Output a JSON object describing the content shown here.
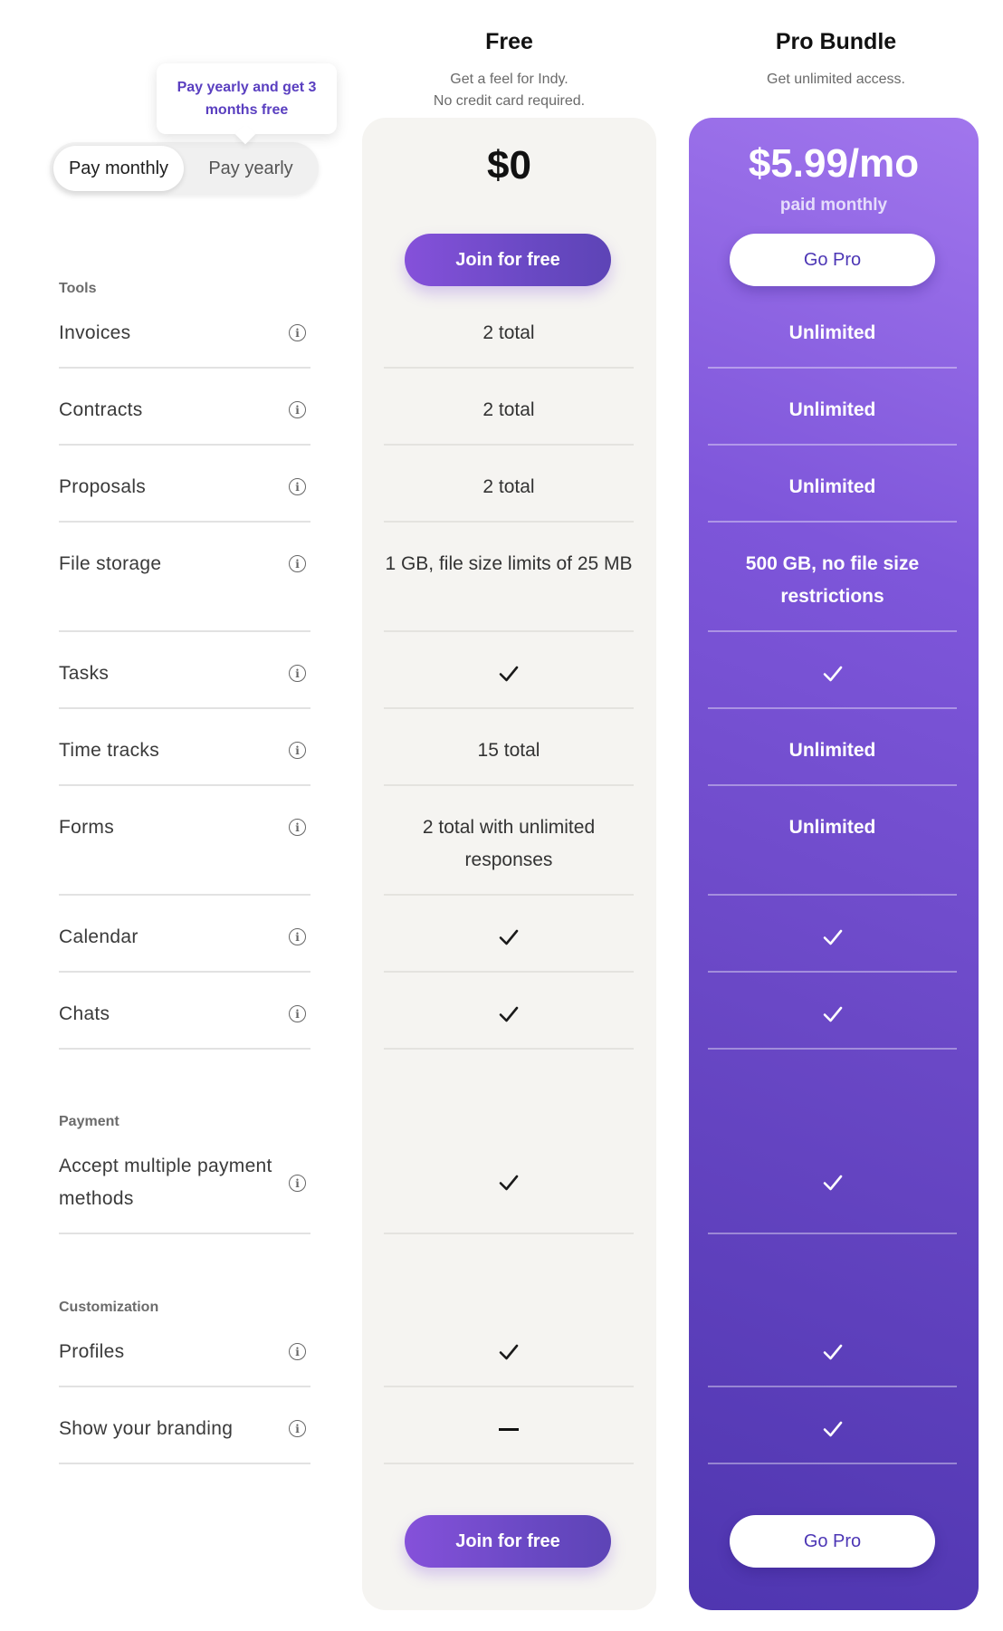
{
  "billing_toggle": {
    "tooltip": "Pay yearly and get 3 months free",
    "options": [
      {
        "label": "Pay monthly",
        "active": true
      },
      {
        "label": "Pay yearly",
        "active": false
      }
    ]
  },
  "plans": {
    "free": {
      "name": "Free",
      "description_lines": [
        "Get a feel for Indy.",
        "No credit card required."
      ],
      "price": "$0",
      "cta_label": "Join for free"
    },
    "pro": {
      "name": "Pro Bundle",
      "description_lines": [
        "Get unlimited access."
      ],
      "price": "$5.99/mo",
      "price_sub": "paid monthly",
      "cta_label": "Go Pro"
    }
  },
  "colors": {
    "accent": "#6a48c6",
    "tooltip_text": "#5a3fc0",
    "free_card_bg": "#f5f4f1",
    "pro_gradient_top": "#a176ed",
    "pro_gradient_bottom": "#4f36b0"
  },
  "sections": [
    {
      "title": "Tools",
      "features": [
        {
          "label": "Invoices",
          "free": "2 total",
          "pro": "Unlimited"
        },
        {
          "label": "Contracts",
          "free": "2 total",
          "pro": "Unlimited"
        },
        {
          "label": "Proposals",
          "free": "2 total",
          "pro": "Unlimited"
        },
        {
          "label": "File storage",
          "free": "1 GB, file size limits of 25 MB",
          "pro": "500 GB, no file size restrictions",
          "tall": true
        },
        {
          "label": "Tasks",
          "free": "check",
          "pro": "check"
        },
        {
          "label": "Time tracks",
          "free": "15 total",
          "pro": "Unlimited"
        },
        {
          "label": "Forms",
          "free": "2 total with unlimited responses",
          "pro": "Unlimited",
          "tall": true
        },
        {
          "label": "Calendar",
          "free": "check",
          "pro": "check"
        },
        {
          "label": "Chats",
          "free": "check",
          "pro": "check"
        }
      ]
    },
    {
      "title": "Payment",
      "features": [
        {
          "label": "Accept multiple payment methods",
          "free": "check",
          "pro": "check",
          "tall": true
        }
      ]
    },
    {
      "title": "Customization",
      "features": [
        {
          "label": "Profiles",
          "free": "check",
          "pro": "check"
        },
        {
          "label": "Show your branding",
          "free": "dash",
          "pro": "check"
        }
      ]
    }
  ],
  "icons": {
    "info": "info-circle-icon",
    "included": "checkmark-icon",
    "not_included": "dash-icon"
  }
}
